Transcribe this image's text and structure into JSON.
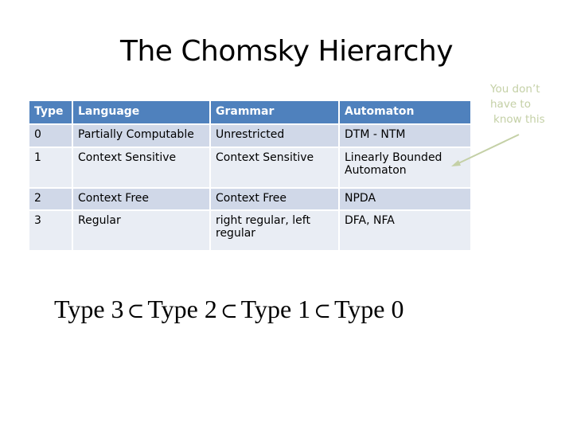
{
  "title": "The Chomsky Hierarchy",
  "table": {
    "headers": [
      "Type",
      "Language",
      "Grammar",
      "Automaton"
    ],
    "rows": [
      {
        "type": "0",
        "language": "Partially Computable",
        "grammar": "Unrestricted",
        "automaton": "DTM - NTM"
      },
      {
        "type": "1",
        "language": "Context Sensitive",
        "grammar": "Context Sensitive",
        "automaton": "Linearly Bounded Automaton"
      },
      {
        "type": "2",
        "language": "Context Free",
        "grammar": "Context Free",
        "automaton": "NPDA"
      },
      {
        "type": "3",
        "language": "Regular",
        "grammar": "right regular, left regular",
        "automaton": "DFA, NFA"
      }
    ]
  },
  "formula": {
    "terms": [
      "Type 3",
      "Type 2",
      "Type 1",
      "Type 0"
    ],
    "operator": "⊂"
  },
  "note": {
    "lines": [
      "You don’t",
      "have to",
      "know this"
    ],
    "color": "#c4d0a6"
  },
  "colors": {
    "header_bg": "#4f81bd",
    "row_odd_bg": "#d0d8e8",
    "row_even_bg": "#e9edf4"
  }
}
